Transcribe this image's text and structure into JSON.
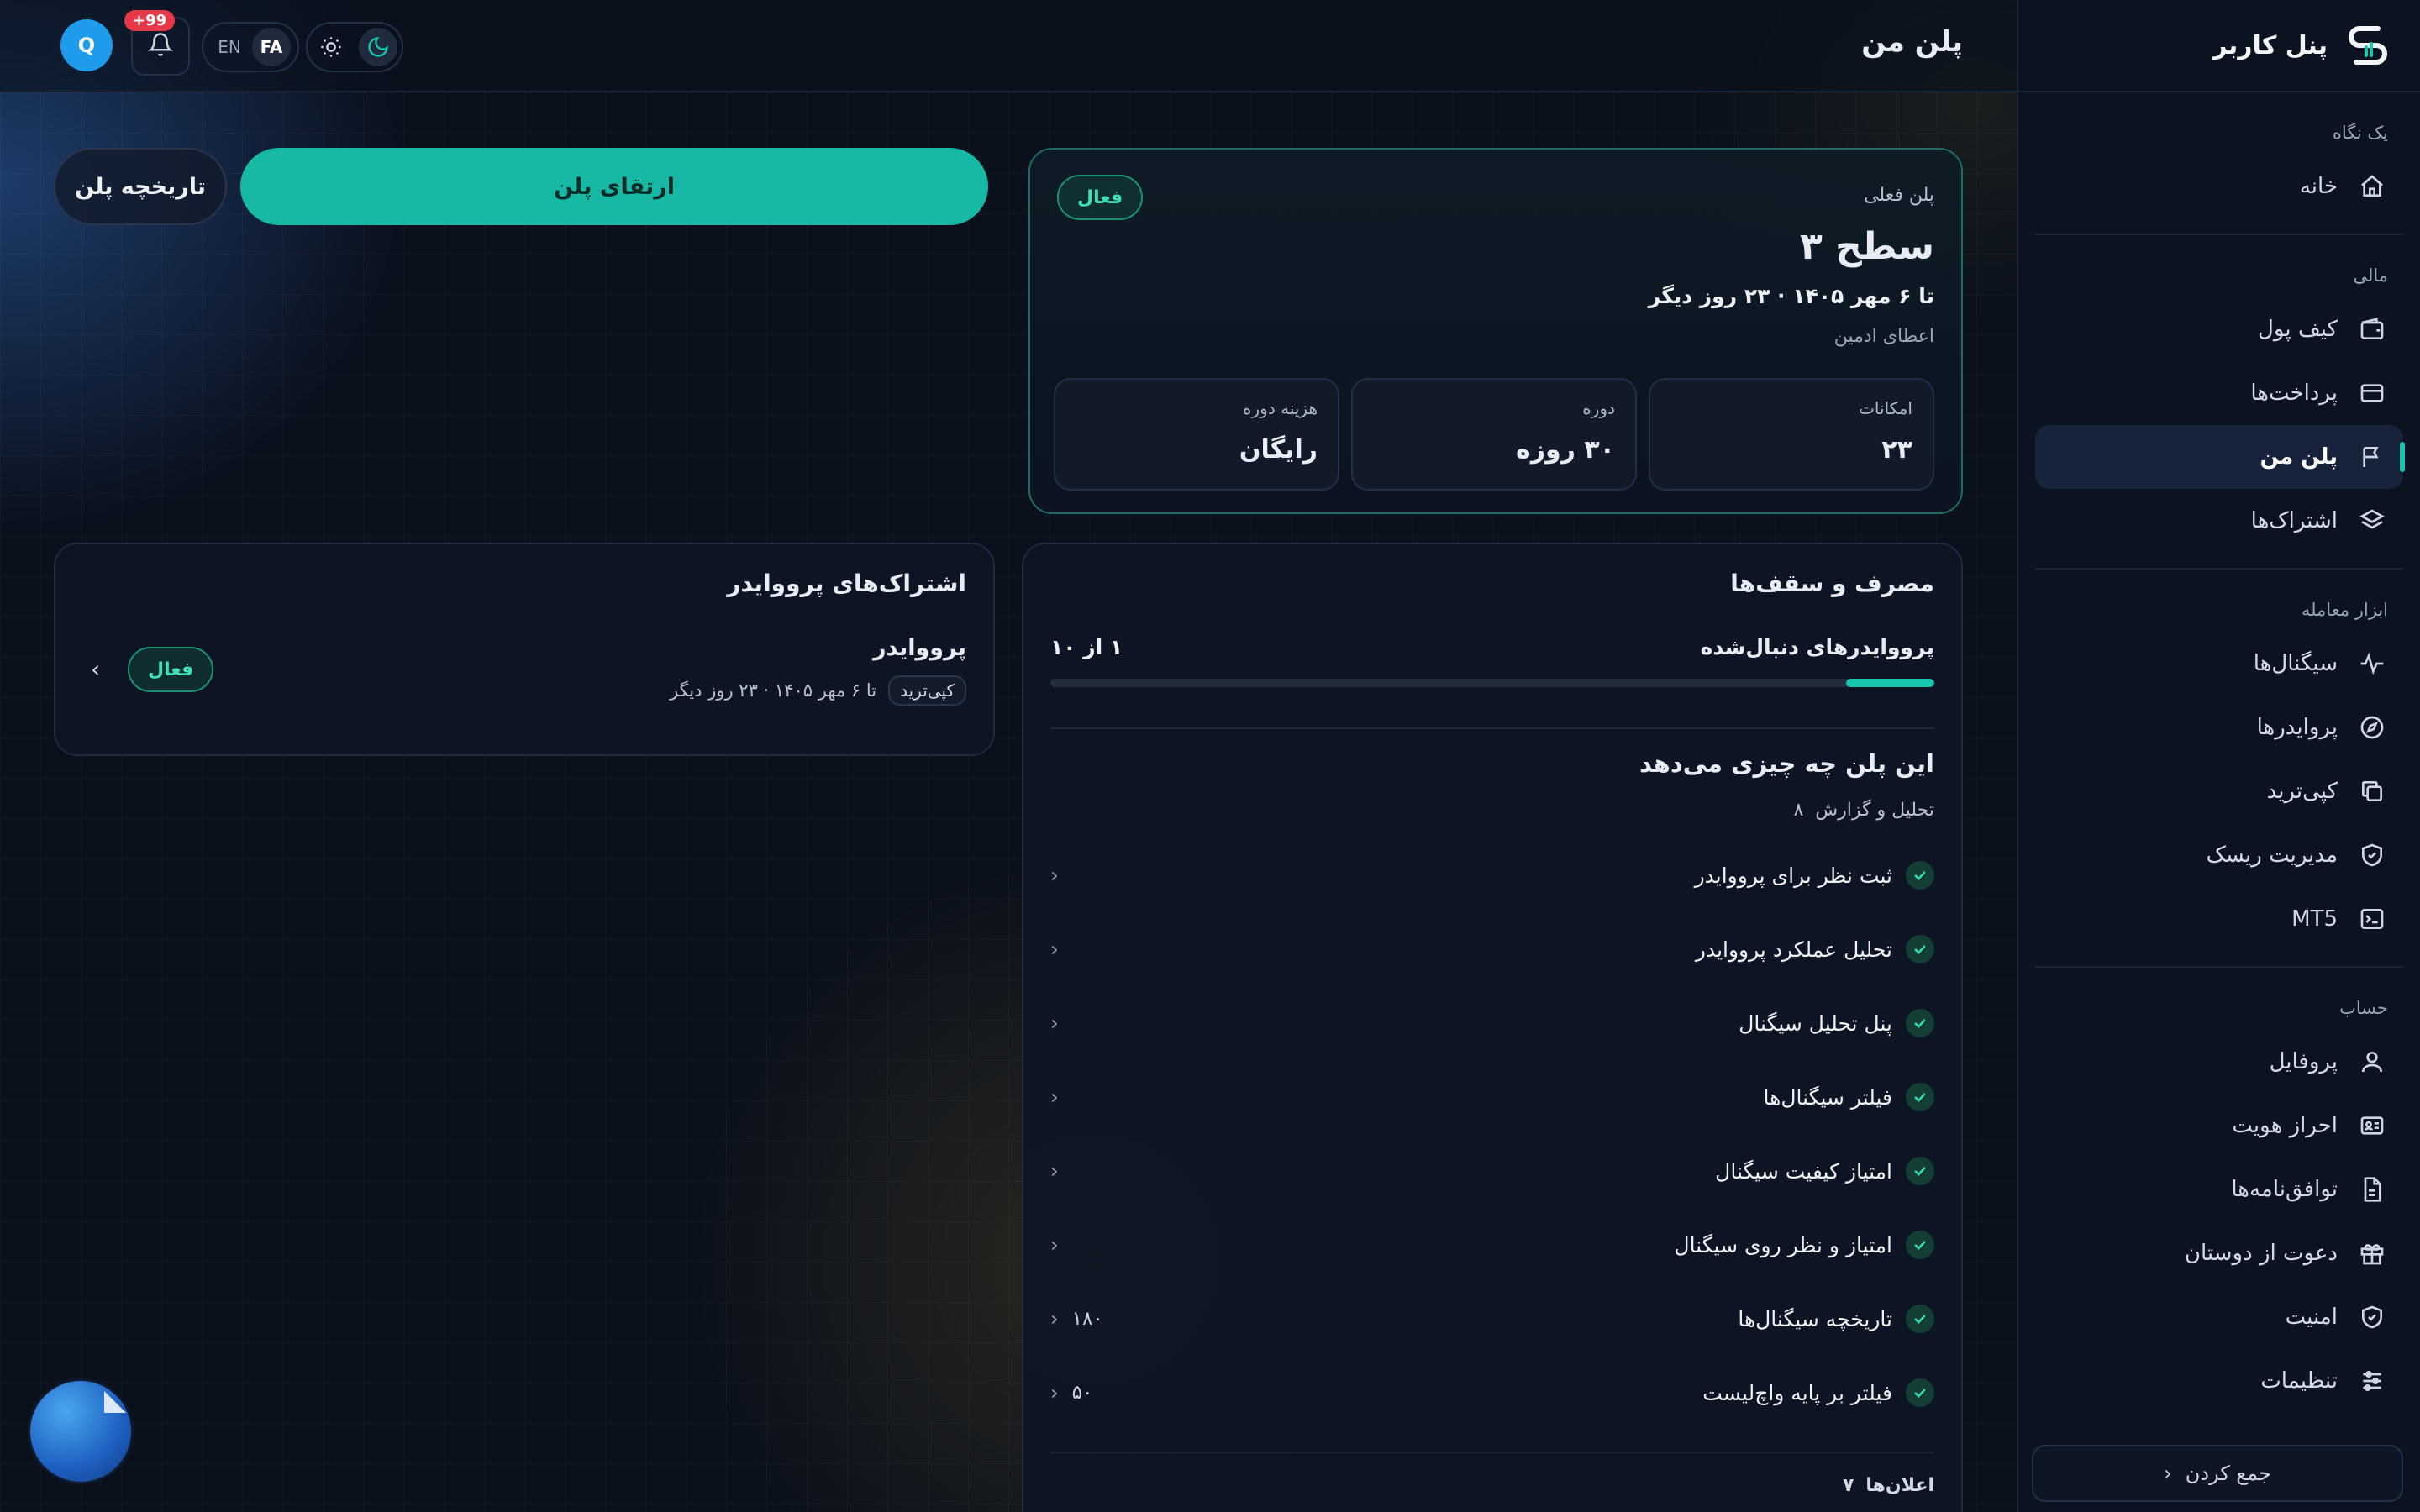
{
  "brand": {
    "name": "پنل کاربر"
  },
  "topbar": {
    "title": "پلن من",
    "avatar_initial": "Q",
    "notif_badge": "+99",
    "lang_fa": "FA",
    "lang_en": "EN"
  },
  "sidebar": {
    "groups": [
      {
        "title": "یک نگاه",
        "items": [
          {
            "label": "خانه",
            "icon": "home-icon"
          }
        ]
      },
      {
        "title": "مالی",
        "items": [
          {
            "label": "کیف پول",
            "icon": "wallet-icon"
          },
          {
            "label": "پرداخت‌ها",
            "icon": "credit-card-icon"
          },
          {
            "label": "پلن من",
            "icon": "flag-icon",
            "active": true
          },
          {
            "label": "اشتراک‌ها",
            "icon": "layers-icon"
          }
        ]
      },
      {
        "title": "ابزار معامله",
        "items": [
          {
            "label": "سیگنال‌ها",
            "icon": "activity-icon"
          },
          {
            "label": "پروایدرها",
            "icon": "compass-icon"
          },
          {
            "label": "کپی‌ترید",
            "icon": "copy-icon"
          },
          {
            "label": "مدیریت ریسک",
            "icon": "shield-icon"
          },
          {
            "label": "MT5",
            "icon": "terminal-icon"
          }
        ]
      },
      {
        "title": "حساب",
        "items": [
          {
            "label": "پروفایل",
            "icon": "user-icon"
          },
          {
            "label": "احراز هویت",
            "icon": "id-card-icon"
          },
          {
            "label": "توافق‌نامه‌ها",
            "icon": "file-icon"
          },
          {
            "label": "دعوت از دوستان",
            "icon": "gift-icon"
          },
          {
            "label": "امنیت",
            "icon": "shield-check-icon"
          },
          {
            "label": "تنظیمات",
            "icon": "sliders-icon"
          }
        ]
      }
    ],
    "collapse_label": "جمع کردن"
  },
  "plan": {
    "label": "پلن فعلی",
    "status": "فعال",
    "level": "سطح ۳",
    "until": "تا ۶ مهر ۱۴۰۵ · ۲۳ روز دیگر",
    "grant": "اعطای ادمین",
    "stats": [
      {
        "key": "امکانات",
        "value": "۲۳"
      },
      {
        "key": "دوره",
        "value": "۳۰ روزه"
      },
      {
        "key": "هزینه دوره",
        "value": "رایگان"
      }
    ]
  },
  "actions": {
    "upgrade": "ارتقای پلن",
    "history": "تاریخچه پلن"
  },
  "provider_subs": {
    "title": "اشتراک‌های پرووایدر",
    "name": "پرووایدر",
    "tag": "کپی‌ترید",
    "until": "تا ۶ مهر ۱۴۰۵ · ۲۳ روز دیگر",
    "status": "فعال"
  },
  "usage": {
    "title": "مصرف و سقف‌ها",
    "row_label": "پرووایدرهای دنبال‌شده",
    "row_value": "۱ از ۱۰",
    "row_fraction": 0.1,
    "features_title": "این پلن چه چیزی می‌دهد",
    "features_group": "تحلیل و گزارش",
    "features_group_count": "۸",
    "features": [
      {
        "name": "ثبت نظر برای پرووایدر",
        "value": ""
      },
      {
        "name": "تحلیل عملکرد پرووایدر",
        "value": ""
      },
      {
        "name": "پنل تحلیل سیگنال",
        "value": ""
      },
      {
        "name": "فیلتر سیگنال‌ها",
        "value": ""
      },
      {
        "name": "امتیاز کیفیت سیگنال",
        "value": ""
      },
      {
        "name": "امتیاز و نظر روی سیگنال",
        "value": ""
      },
      {
        "name": "تاریخچه سیگنال‌ها",
        "value": "۱۸۰"
      },
      {
        "name": "فیلتر بر پایه واچ‌لیست",
        "value": "۵۰"
      }
    ],
    "announcements": "اعلان‌ها",
    "announcements_count": "۷"
  }
}
